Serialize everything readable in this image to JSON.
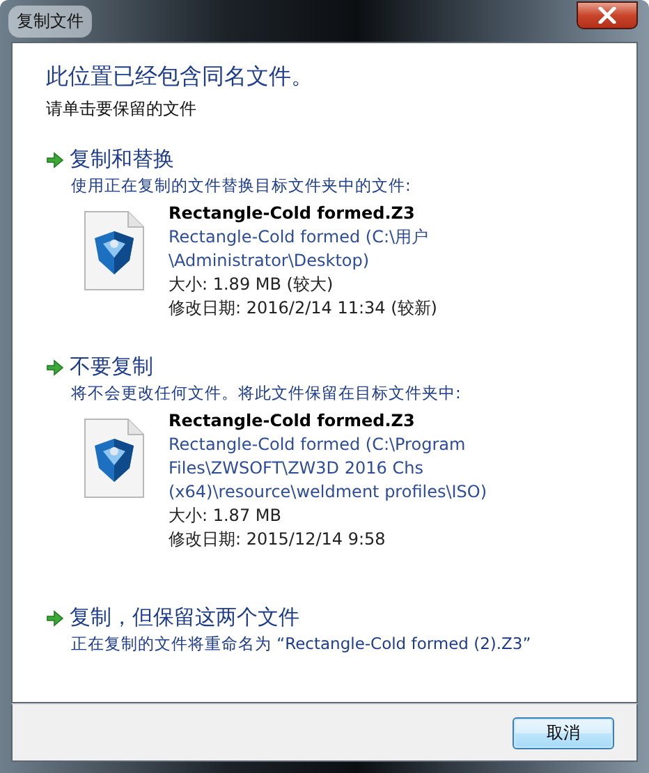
{
  "window": {
    "title": "复制文件"
  },
  "heading": "此位置已经包含同名文件。",
  "subtitle": "请单击要保留的文件",
  "options": [
    {
      "title": "复制和替换",
      "description": "使用正在复制的文件替换目标文件夹中的文件:",
      "file": {
        "name": "Rectangle-Cold formed.Z3",
        "path_lines": [
          "Rectangle-Cold formed (C:\\用户",
          "\\Administrator\\Desktop)"
        ],
        "size": "大小: 1.89 MB (较大)",
        "modified": "修改日期: 2016/2/14 11:34 (较新)"
      }
    },
    {
      "title": "不要复制",
      "description": "将不会更改任何文件。将此文件保留在目标文件夹中:",
      "file": {
        "name": "Rectangle-Cold formed.Z3",
        "path_lines": [
          "Rectangle-Cold formed (C:\\Program",
          "Files\\ZWSOFT\\ZW3D 2016 Chs",
          "(x64)\\resource\\weldment profiles\\ISO)"
        ],
        "size": "大小: 1.87 MB",
        "modified": "修改日期: 2015/12/14 9:58"
      }
    },
    {
      "title": "复制，但保留这两个文件",
      "description": "正在复制的文件将重命名为 “Rectangle-Cold formed (2).Z3”"
    }
  ],
  "buttons": [
    "取消"
  ]
}
